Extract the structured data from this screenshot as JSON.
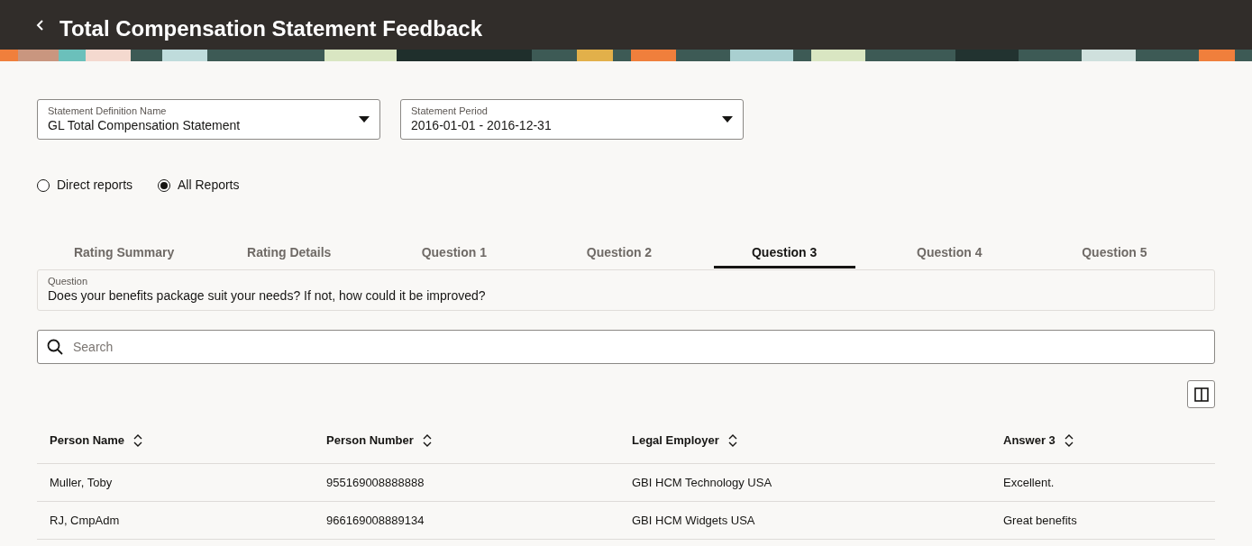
{
  "header": {
    "title": "Total Compensation Statement Feedback"
  },
  "filters": [
    {
      "label": "Statement Definition Name",
      "value": "GL Total Compensation Statement"
    },
    {
      "label": "Statement Period",
      "value": "2016-01-01 - 2016-12-31"
    }
  ],
  "report_scope": [
    {
      "label": "Direct reports",
      "selected": false
    },
    {
      "label": "All Reports",
      "selected": true
    }
  ],
  "tabs": [
    {
      "label": "Rating Summary",
      "selected": false
    },
    {
      "label": "Rating Details",
      "selected": false
    },
    {
      "label": "Question 1",
      "selected": false
    },
    {
      "label": "Question 2",
      "selected": false
    },
    {
      "label": "Question 3",
      "selected": true
    },
    {
      "label": "Question 4",
      "selected": false
    },
    {
      "label": "Question 5",
      "selected": false
    }
  ],
  "question": {
    "label": "Question",
    "text": "Does your benefits package suit your needs? If not, how could it be improved?"
  },
  "search": {
    "placeholder": "Search"
  },
  "table": {
    "columns": [
      "Person Name",
      "Person Number",
      "Legal Employer",
      "Answer 3"
    ],
    "rows": [
      [
        "Muller, Toby",
        "955169008888888",
        "GBI HCM Technology USA",
        "Excellent."
      ],
      [
        "RJ, CmpAdm",
        "966169008889134",
        "GBI HCM Widgets USA",
        "Great benefits"
      ]
    ]
  }
}
